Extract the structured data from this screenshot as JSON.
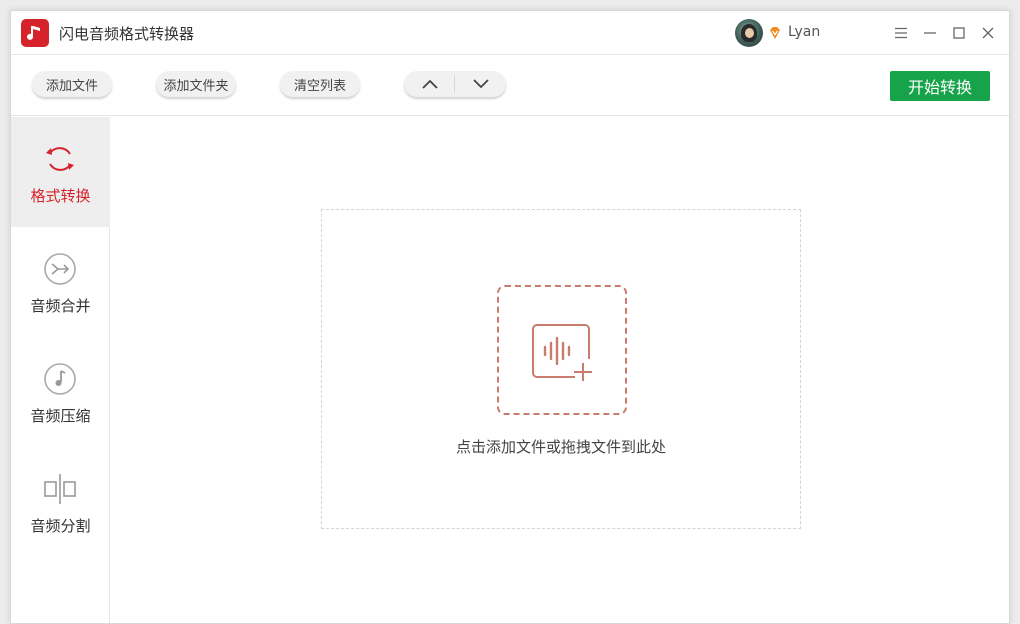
{
  "app": {
    "title": "闪电音频格式转换器",
    "logo_icon": "music-note-icon",
    "brand_color": "#d6232b"
  },
  "user": {
    "name": "Lyan",
    "vip_icon": "vip-diamond-icon"
  },
  "window_controls": [
    "menu-icon",
    "minimize-icon",
    "maximize-icon",
    "close-icon"
  ],
  "toolbar": {
    "add_file_label": "添加文件",
    "add_folder_label": "添加文件夹",
    "clear_list_label": "清空列表",
    "move_up_icon": "chevron-up-icon",
    "move_down_icon": "chevron-down-icon",
    "start_label": "开始转换",
    "start_color": "#17a34a"
  },
  "sidebar": {
    "items": [
      {
        "label": "格式转换",
        "icon": "convert-cycle-icon",
        "active": true
      },
      {
        "label": "音频合并",
        "icon": "merge-icon",
        "active": false
      },
      {
        "label": "音频压缩",
        "icon": "music-disc-icon",
        "active": false
      },
      {
        "label": "音频分割",
        "icon": "split-icon",
        "active": false
      }
    ]
  },
  "dropzone": {
    "icon": "add-audio-icon",
    "hint": "点击添加文件或拖拽文件到此处"
  }
}
